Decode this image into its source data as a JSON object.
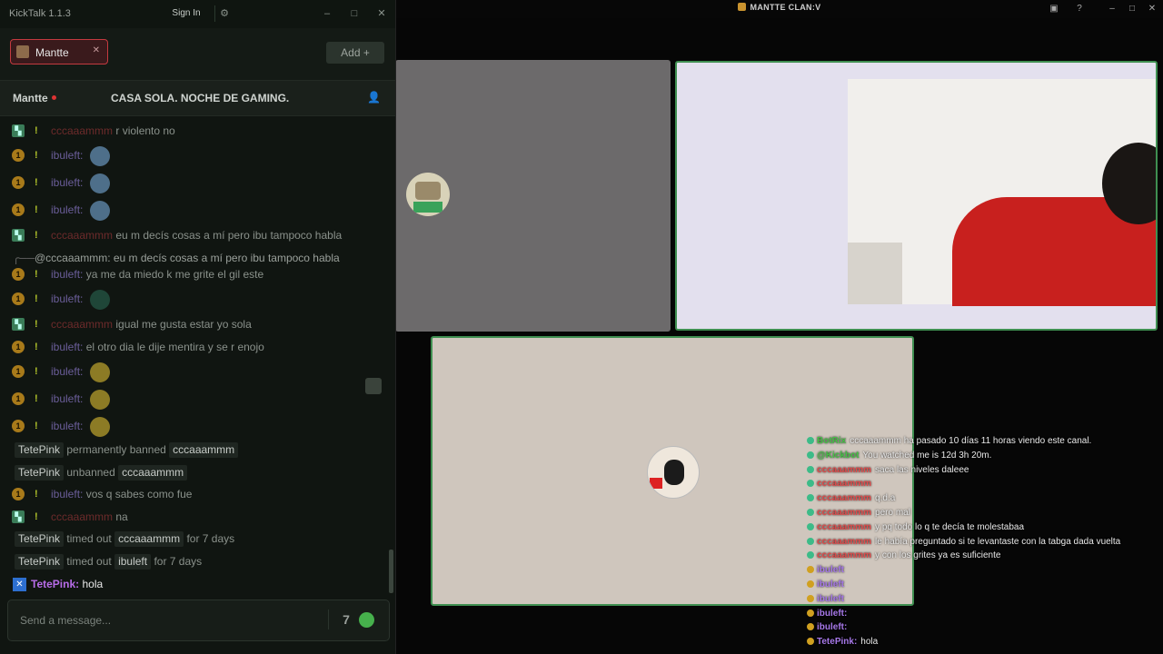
{
  "discord": {
    "title": "MANTTE CLAN:V"
  },
  "kicktalk": {
    "app_name": "KickTalk 1.1.3",
    "sign_in": "Sign In",
    "tab": {
      "label": "Mantte"
    },
    "add_label": "Add",
    "channel": {
      "name": "Mantte",
      "stream_title": "CASA SOLA. NOCHE DE GAMING."
    },
    "messages": [
      {
        "user": "cccaaammm",
        "user_color": "red",
        "badge": "green",
        "text": "r violento no"
      },
      {
        "user": "ibuleft:",
        "user_color": "purple",
        "badge": "gold",
        "text": ""
      },
      {
        "user": "ibuleft:",
        "user_color": "purple",
        "badge": "gold",
        "text": ""
      },
      {
        "user": "ibuleft:",
        "user_color": "purple",
        "badge": "gold",
        "text": ""
      },
      {
        "user": "cccaaammm",
        "user_color": "red",
        "badge": "green",
        "text": "eu m decís cosas a mí pero ibu tampoco habla"
      },
      {
        "user": "ibuleft:",
        "user_color": "purple",
        "badge": "gold",
        "text": "ya me da miedo k me grite el gil este"
      },
      {
        "user": "ibuleft:",
        "user_color": "purple",
        "badge": "gold",
        "text": ""
      },
      {
        "user": "cccaaammm",
        "user_color": "red",
        "badge": "green",
        "text": "igual me gusta estar yo sola"
      },
      {
        "user": "ibuleft:",
        "user_color": "purple",
        "badge": "gold",
        "text": "el otro dia le dije mentira y se r enojo"
      },
      {
        "user": "ibuleft:",
        "user_color": "purple",
        "badge": "gold",
        "text": ""
      },
      {
        "user": "ibuleft:",
        "user_color": "purple",
        "badge": "gold",
        "text": ""
      },
      {
        "user": "ibuleft:",
        "user_color": "purple",
        "badge": "gold",
        "text": ""
      }
    ],
    "reply_line": "@cccaaammm: eu m decís cosas a mí pero ibu tampoco habla",
    "system": {
      "ban": {
        "mod": "TetePink",
        "action": "permanently banned",
        "target": "cccaaammm"
      },
      "unban": {
        "mod": "TetePink",
        "action": "unbanned",
        "target": "cccaaammm"
      },
      "msg_vos": {
        "user": "ibuleft:",
        "text": "vos q sabes como fue"
      },
      "msg_na": {
        "user": "cccaaammm",
        "text": "na"
      },
      "timeout1": {
        "mod": "TetePink",
        "action": "timed out",
        "target": "cccaaammm",
        "dur": "for 7 days"
      },
      "timeout2": {
        "mod": "TetePink",
        "action": "timed out",
        "target": "ibuleft",
        "dur": "for 7 days"
      },
      "last": {
        "user": "TetePink:",
        "text": "hola"
      }
    },
    "input_placeholder": "Send a message..."
  },
  "overlay": {
    "lines": [
      {
        "user": "BotRix",
        "user_color": "#46c046",
        "text": "cccaaammm ha pasado 10 días 11 horas viendo este canal."
      },
      {
        "user": "@Kickbot",
        "user_color": "#46c046",
        "text": "You watched me is 12d 3h 20m."
      },
      {
        "user": "cccaaammm",
        "user_color": "#e04a4a",
        "text": "saca las niveles daleee"
      },
      {
        "user": "cccaaammm",
        "user_color": "#e04a4a",
        "text": ""
      },
      {
        "user": "cccaaammm",
        "user_color": "#e04a4a",
        "text": "q.d.a"
      },
      {
        "user": "cccaaammm",
        "user_color": "#e04a4a",
        "text": "pero mal"
      },
      {
        "user": "cccaaammm",
        "user_color": "#e04a4a",
        "text": "y pq todo lo q te decía te molestabaa"
      },
      {
        "user": "cccaaammm",
        "user_color": "#e04a4a",
        "text": "le había preguntado si te levantaste con la tabga dada vuelta"
      },
      {
        "user": "cccaaammm",
        "user_color": "#e04a4a",
        "text": "y con los grites ya es suficiente"
      },
      {
        "user": "ibuleft",
        "user_color": "#a678e8",
        "text": ""
      },
      {
        "user": "ibuleft",
        "user_color": "#a678e8",
        "text": ""
      },
      {
        "user": "ibuleft",
        "user_color": "#a678e8",
        "text": ""
      },
      {
        "user": "ibuleft:",
        "user_color": "#a678e8",
        "text": ""
      },
      {
        "user": "ibuleft:",
        "user_color": "#a678e8",
        "text": ""
      },
      {
        "user": "TetePink:",
        "user_color": "#a678e8",
        "text": "hola"
      }
    ]
  }
}
